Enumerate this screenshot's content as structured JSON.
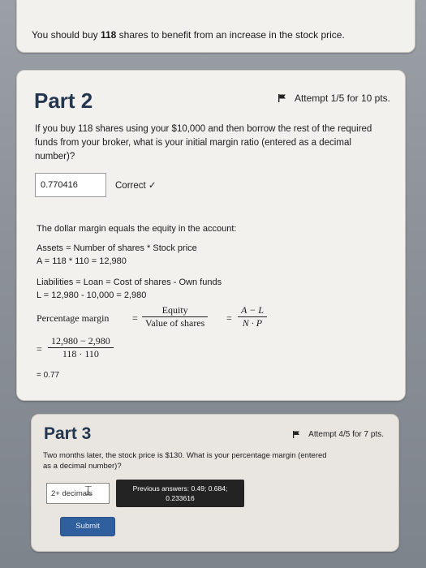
{
  "top": {
    "text_before": "You should buy ",
    "shares": "118",
    "text_after": " shares to benefit from an increase in the stock price."
  },
  "part2": {
    "title": "Part 2",
    "attempt": "Attempt 1/5 for 10 pts.",
    "question": "If you buy 118 shares using your $10,000 and then borrow the rest of the required funds from your broker, what is your initial margin ratio (entered as a decimal number)?",
    "answer_value": "0.770416",
    "correct_label": "Correct ✓",
    "explanation": {
      "line1": "The dollar margin equals the equity in the account:",
      "assets_def": "Assets = Number of shares * Stock price",
      "assets_calc": "A = 118 * 110 = 12,980",
      "liab_def": "Liabilities = Loan = Cost of shares - Own funds",
      "liab_calc": "L = 12,980 - 10,000 = 2,980",
      "pm_label": "Percentage margin",
      "equity": "Equity",
      "value_of_shares": "Value of shares",
      "a_minus_l": "A − L",
      "n_p": "N · P",
      "num_calc": "12,980 − 2,980",
      "den_calc": "118 · 110",
      "result": "= 0.77"
    }
  },
  "part3": {
    "title": "Part 3",
    "attempt": "Attempt 4/5 for 7 pts.",
    "question": "Two months later, the stock price is $130. What is your percentage margin (entered as a decimal number)?",
    "input_placeholder": "2+ decimals",
    "prev_answers_label": "Previous answers: 0.49; 0.684;",
    "prev_answers_line2": "0.233616",
    "submit_label": "Submit"
  }
}
